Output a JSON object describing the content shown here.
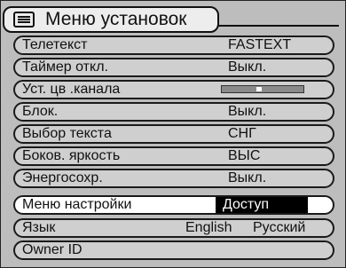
{
  "title": "Меню установок",
  "items": [
    {
      "label": "Телетекст",
      "value": "FASTEXT"
    },
    {
      "label": "Таймер откл.",
      "value": "Выкл."
    },
    {
      "label": "Уст. цв .канала",
      "slider_level": 0.45
    },
    {
      "label": "Блок.",
      "value": "Выкл."
    },
    {
      "label": "Выбор текста",
      "value": "СНГ"
    },
    {
      "label": "Боков. яркость",
      "value": "ВЫС"
    },
    {
      "label": "Энергосохр.",
      "value": "Выкл."
    },
    {
      "label": "Меню настройки",
      "value": "Доступ",
      "selected": true
    },
    {
      "label": "Язык",
      "options": [
        "English",
        "Русский"
      ],
      "selected_option": "Русский"
    },
    {
      "label": "Owner ID"
    }
  ]
}
